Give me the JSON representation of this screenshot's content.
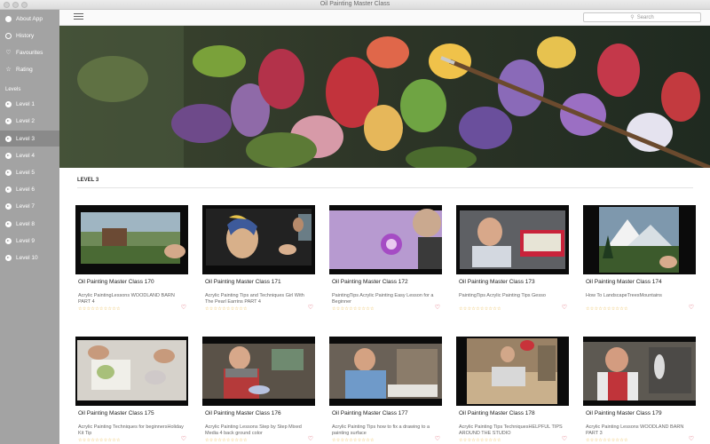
{
  "window": {
    "title": "Oil Painting Master Class"
  },
  "sidebar": {
    "top_items": [
      {
        "label": "About App",
        "icon": "info-circle-icon"
      },
      {
        "label": "History",
        "icon": "clock-icon"
      },
      {
        "label": "Favourites",
        "icon": "heart-icon"
      },
      {
        "label": "Rating",
        "icon": "star-icon"
      }
    ],
    "section_label": "Levels",
    "levels": [
      {
        "label": "Level 1"
      },
      {
        "label": "Level 2"
      },
      {
        "label": "Level 3",
        "active": true
      },
      {
        "label": "Level 4"
      },
      {
        "label": "Level 5"
      },
      {
        "label": "Level 6"
      },
      {
        "label": "Level 7"
      },
      {
        "label": "Level 8"
      },
      {
        "label": "Level 9"
      },
      {
        "label": "Level 10"
      }
    ]
  },
  "toolbar": {
    "search_placeholder": "Search"
  },
  "content": {
    "level_title": "LEVEL 3",
    "cards": [
      {
        "title": "Oil Painting Master Class 170",
        "desc": "Acrylic PaintingLessons WOODLAND BARN PART 4",
        "stars": "☆☆☆☆☆☆☆☆☆☆",
        "theme": "barn"
      },
      {
        "title": "Oil Painting Master Class 171",
        "desc": "Acrylic Painting Tips and Techniques Girl With The Pearl Earrins PART 4",
        "stars": "☆☆☆☆☆☆☆☆☆☆",
        "theme": "pearl"
      },
      {
        "title": "Oil Painting Master Class 172",
        "desc": "PaintingTips Acrylic Painting Easy Lesson for a Beginner",
        "stars": "☆☆☆☆☆☆☆☆☆☆",
        "theme": "purple"
      },
      {
        "title": "Oil Painting Master Class 173",
        "desc": "PaintingTips Acrylic Painting Tips Gesso",
        "stars": "☆☆☆☆☆☆☆☆☆☆",
        "theme": "studio"
      },
      {
        "title": "Oil Painting Master Class 174",
        "desc": "How To LandscapeTreesMountains",
        "stars": "☆☆☆☆☆☆☆☆☆☆",
        "theme": "mountain"
      },
      {
        "title": "Oil Painting Master Class 175",
        "desc": "Acrylic Painting Techniques for beginnersHoliday Kit Tip",
        "stars": "☆☆☆☆☆☆☆☆☆☆",
        "theme": "hands"
      },
      {
        "title": "Oil Painting Master Class 176",
        "desc": "Acrylic Painting Lessons Step by Step Mixed Media 4 back ground color",
        "stars": "☆☆☆☆☆☆☆☆☆☆",
        "theme": "man-apron"
      },
      {
        "title": "Oil Painting Master Class 177",
        "desc": "Acrylic Painting Tips how to fix a drawing to a painting surface",
        "stars": "☆☆☆☆☆☆☆☆☆☆",
        "theme": "man-blue"
      },
      {
        "title": "Oil Painting Master Class 178",
        "desc": "Acrylic Painting Tips TechniquesHELPFUL TIPS AROUND THE STUDIO",
        "stars": "☆☆☆☆☆☆☆☆☆☆",
        "theme": "studio-room"
      },
      {
        "title": "Oil Painting Master Class 179",
        "desc": "Acrylic Painting Lessons WOODLAND BARN PART 3",
        "stars": "☆☆☆☆☆☆☆☆☆☆",
        "theme": "man-red"
      }
    ]
  },
  "colors": {
    "sidebar_bg": "#a3a3a3",
    "sidebar_active": "#8a8a8a",
    "heart": "#d9475a",
    "stars": "#e5a820"
  }
}
